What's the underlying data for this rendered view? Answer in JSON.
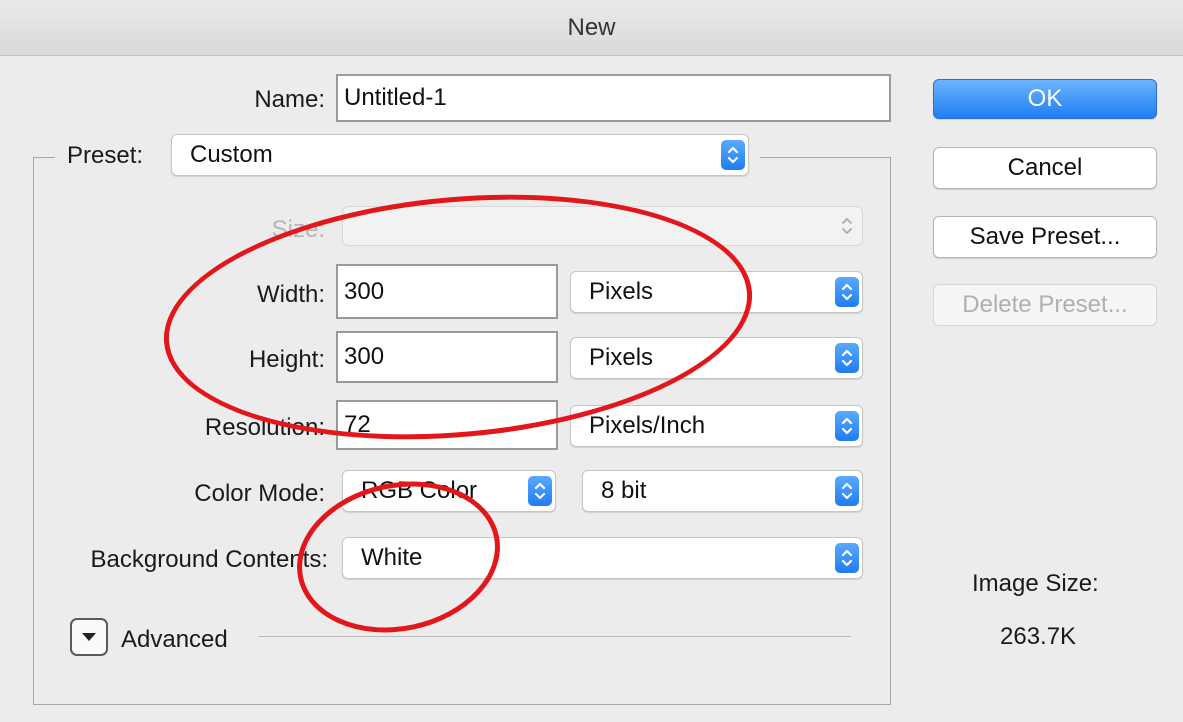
{
  "window": {
    "title": "New"
  },
  "form": {
    "name_label": "Name:",
    "name_value": "Untitled-1",
    "preset_label": "Preset:",
    "preset_value": "Custom",
    "size_label": "Size:",
    "size_value": "",
    "width_label": "Width:",
    "width_value": "300",
    "width_unit": "Pixels",
    "height_label": "Height:",
    "height_value": "300",
    "height_unit": "Pixels",
    "resolution_label": "Resolution:",
    "resolution_value": "72",
    "resolution_unit": "Pixels/Inch",
    "color_mode_label": "Color Mode:",
    "color_mode_value": "RGB Color",
    "bit_depth_value": "8 bit",
    "background_label": "Background Contents:",
    "background_value": "White",
    "advanced_label": "Advanced"
  },
  "buttons": {
    "ok": "OK",
    "cancel": "Cancel",
    "save_preset": "Save Preset...",
    "delete_preset": "Delete Preset..."
  },
  "info": {
    "image_size_label": "Image Size:",
    "image_size_value": "263.7K"
  },
  "colors": {
    "accent": "#1f7ef2",
    "annotation": "#e3161b",
    "background": "#ececec"
  },
  "icons": {
    "popup_stepper": "up-down-chevron-icon",
    "advanced_toggle": "disclosure-triangle-icon"
  }
}
